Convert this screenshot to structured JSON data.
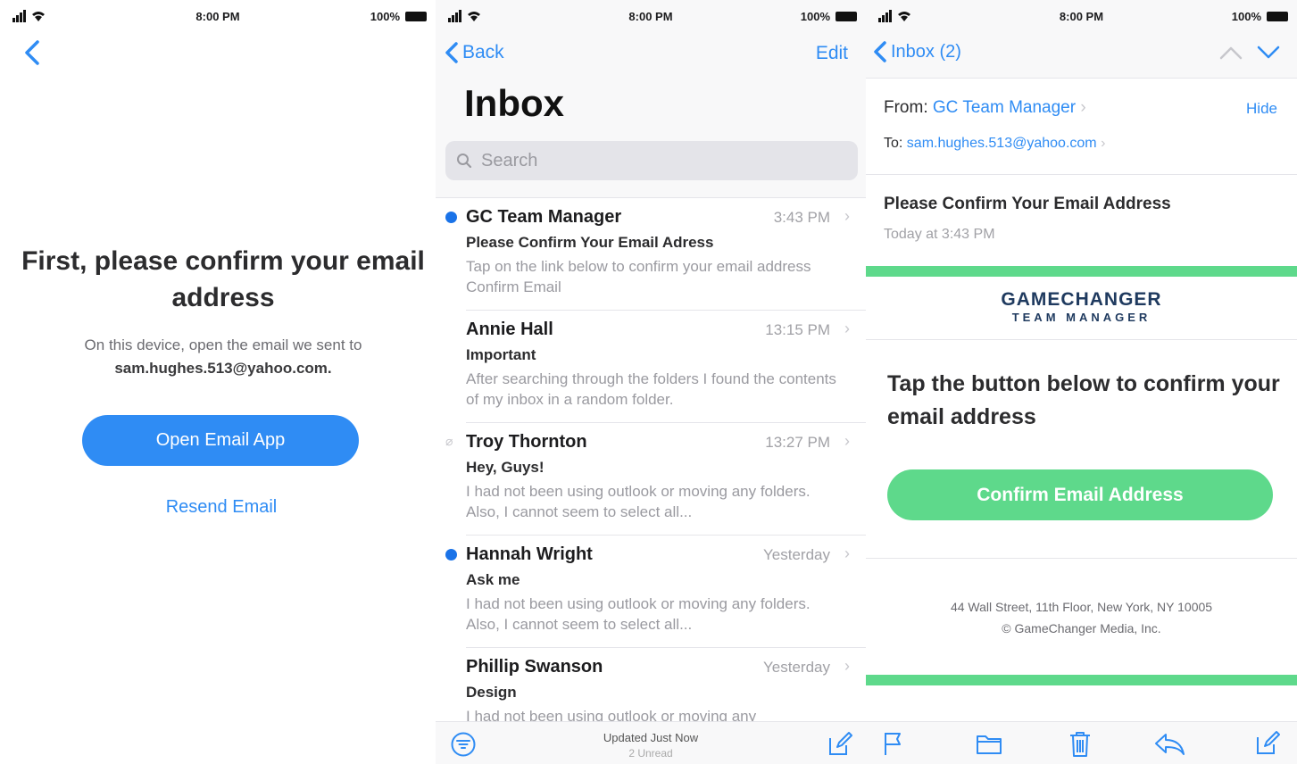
{
  "status": {
    "time": "8:00 PM",
    "battery": "100%"
  },
  "screen1": {
    "title": "First, please confirm your email address",
    "desc_line1": "On this device, open the email we sent to",
    "desc_email": "sam.hughes.513@yahoo.com.",
    "open_button": "Open Email App",
    "resend": "Resend Email",
    "accent": "#2f8cf4"
  },
  "screen2": {
    "back": "Back",
    "edit": "Edit",
    "title": "Inbox",
    "search_placeholder": "Search",
    "mails": [
      {
        "sender": "GC Team Manager",
        "time": "3:43 PM",
        "subject": "Please Confirm Your Email Adress",
        "preview": "Tap on the link below to confirm your email address Confirm Email",
        "unread": true,
        "attachment": false
      },
      {
        "sender": "Annie Hall",
        "time": "13:15 PM",
        "subject": "Important",
        "preview": "After searching through the folders I found the contents of my inbox in a random folder.",
        "unread": false,
        "attachment": false
      },
      {
        "sender": "Troy Thornton",
        "time": "13:27 PM",
        "subject": "Hey, Guys!",
        "preview": "I had not been using outlook or moving any folders. Also, I cannot seem to select all...",
        "unread": false,
        "attachment": true
      },
      {
        "sender": "Hannah Wright",
        "time": "Yesterday",
        "subject": "Ask me",
        "preview": "I had not been using outlook or moving any folders. Also, I cannot seem to select all...",
        "unread": true,
        "attachment": false
      },
      {
        "sender": "Phillip Swanson",
        "time": "Yesterday",
        "subject": "Design",
        "preview": "I had not been using outlook or moving any",
        "unread": false,
        "attachment": false
      }
    ],
    "footer_updated": "Updated Just Now",
    "footer_unread": "2 Unread"
  },
  "screen3": {
    "back": "Inbox (2)",
    "from_label": "From:",
    "from_name": "GC Team Manager",
    "hide": "Hide",
    "to_label": "To:",
    "to_email": "sam.hughes.513@yahoo.com",
    "subject": "Please Confirm Your Email Address",
    "date": "Today at 3:43 PM",
    "brand_line1": "GAMECHANGER",
    "brand_line2": "TEAM MANAGER",
    "tap_text": "Tap the button below to confirm your email address",
    "confirm_button": "Confirm Email Address",
    "address_line1": "44 Wall Street, 11th Floor, New York, NY 10005",
    "address_line2": "© GameChanger Media, Inc.",
    "green": "#5ed98b"
  }
}
